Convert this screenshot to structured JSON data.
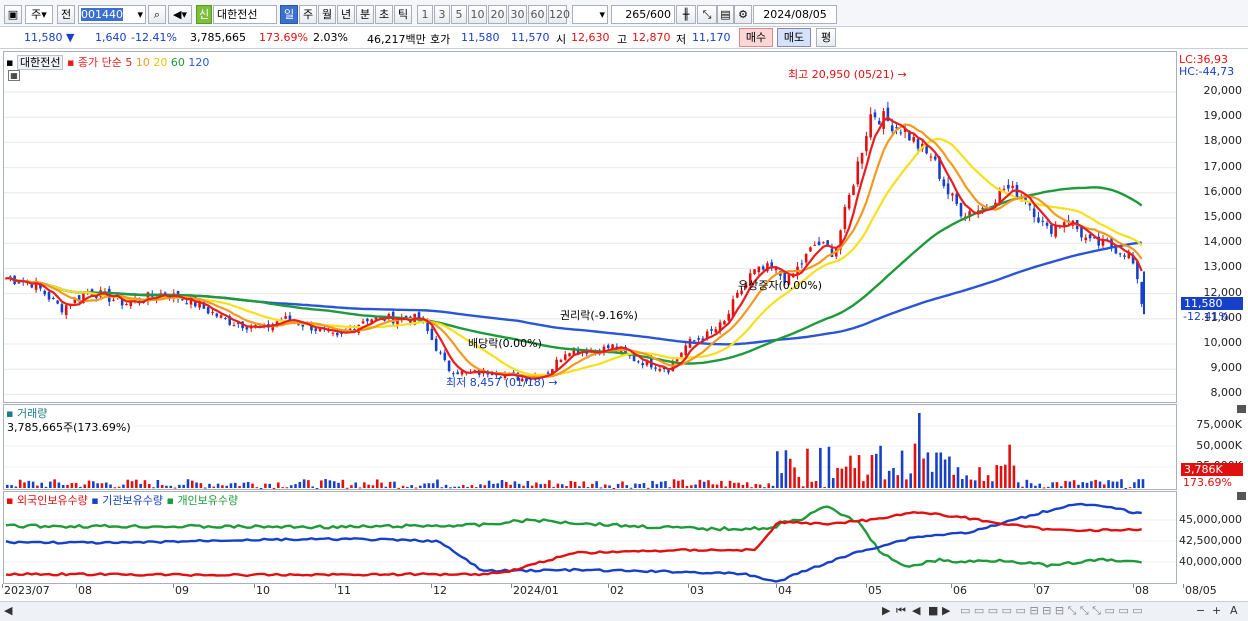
{
  "toolbar": {
    "market": "주",
    "prev": "전",
    "code": "001440",
    "stock_name": "대한전선",
    "flag": "신",
    "periods": [
      "일",
      "주",
      "월",
      "년",
      "분",
      "초",
      "틱"
    ],
    "intervals": [
      "1",
      "3",
      "5",
      "10",
      "20",
      "30",
      "60",
      "120"
    ],
    "count": "265",
    "max_count": "600",
    "date": "2024/08/05"
  },
  "quote": {
    "price": "11,580",
    "change": "1,640",
    "change_pct": "-12.41%",
    "volume": "3,785,665",
    "vol_ratio": "173.69%",
    "turnover_pct": "2.03%",
    "amount": "46,217백만",
    "bid_label": "호가",
    "bid": "11,580",
    "ask": "11,570",
    "open_label": "시",
    "open": "12,630",
    "high_label": "고",
    "high": "12,870",
    "low_label": "저",
    "low": "11,170",
    "buy": "매수",
    "sell": "매도",
    "eval": "평"
  },
  "price_pane": {
    "name": "대한전선",
    "ma_label": "종가 단순 5",
    "ma10": "10",
    "ma20": "20",
    "ma60": "60",
    "ma120": "120",
    "lc": "LC:36,93",
    "hc": "HC:-44,73",
    "current": "11,580",
    "current_pct": "-12.41%",
    "annot_high": "최고 20,950 (05/21) →",
    "annot_low": "최저 8,457 (01/18) →",
    "annot_rights": "권리락(-9.16%)",
    "annot_div": "배당락(0.00%)",
    "annot_issue": "유상증자(0.00%)",
    "yticks": [
      "20,000",
      "19,000",
      "18,000",
      "17,000",
      "16,000",
      "15,000",
      "14,000",
      "13,000",
      "12,000",
      "11,000",
      "10,000",
      "9,000",
      "8,000"
    ]
  },
  "volume_pane": {
    "name": "거래량",
    "value": "3,785,665주(173.69%)",
    "yticks": [
      "75,000K",
      "50,000K",
      "25,000K"
    ],
    "current": "3,786K",
    "current_pct": "173.69%"
  },
  "holding_pane": {
    "foreign": "외국인보유수량",
    "inst": "기관보유수량",
    "indiv": "개인보유수량",
    "yticks": [
      "45,000,000",
      "42,500,000",
      "40,000,000"
    ]
  },
  "xlabels": [
    "2023/07",
    "08",
    "09",
    "10",
    "11",
    "12",
    "2024/01",
    "02",
    "03",
    "04",
    "05",
    "06",
    "07",
    "08",
    "08/05"
  ],
  "colors": {
    "up": "#e01010",
    "down": "#1740c8",
    "ma5": "#e81e1e",
    "ma10": "#f39a1e",
    "ma20": "#f7e01a",
    "ma60": "#1f9a3a",
    "ma120": "#2a56d6"
  }
}
